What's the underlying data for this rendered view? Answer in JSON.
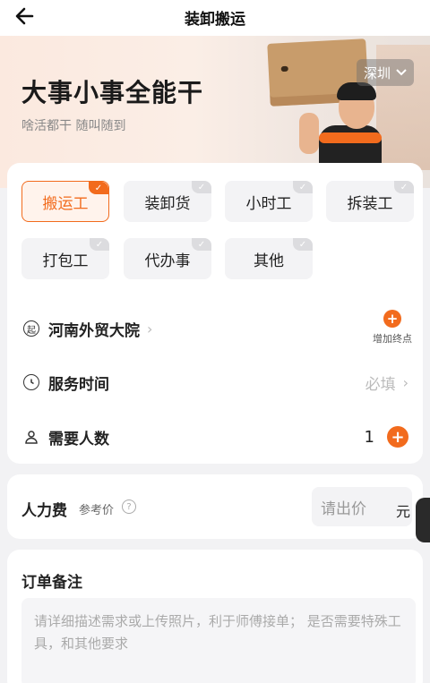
{
  "header": {
    "title": "装卸搬运"
  },
  "hero": {
    "title": "大事小事全能干",
    "subtitle": "啥活都干 随叫随到",
    "city": "深圳"
  },
  "service_types": [
    {
      "label": "搬运工",
      "selected": true
    },
    {
      "label": "装卸货",
      "selected": false
    },
    {
      "label": "小时工",
      "selected": false
    },
    {
      "label": "拆装工",
      "selected": false
    },
    {
      "label": "打包工",
      "selected": false
    },
    {
      "label": "代办事",
      "selected": false
    },
    {
      "label": "其他",
      "selected": false
    }
  ],
  "form": {
    "start_icon": "起",
    "start_address": "河南外贸大院",
    "add_destination": "增加终点",
    "service_time_label": "服务时间",
    "service_time_value": "必填",
    "people_label": "需要人数",
    "people_count": "1"
  },
  "fee": {
    "label": "人力费",
    "reference": "参考价",
    "placeholder": "请出价",
    "unit": "元"
  },
  "note": {
    "title": "订单备注",
    "placeholder": "请详细描述需求或上传照片，利于师傅接单； 是否需要特殊工具，和其他要求"
  },
  "colors": {
    "accent": "#f26b1d",
    "background": "#f2f2f4"
  }
}
